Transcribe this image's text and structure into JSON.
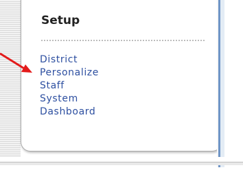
{
  "setup": {
    "title": "Setup",
    "items": [
      {
        "label": "District"
      },
      {
        "label": "Personalize"
      },
      {
        "label": "Staff"
      },
      {
        "label": "System"
      },
      {
        "label": "Dashboard"
      }
    ]
  },
  "annotation": {
    "color": "#e31b1b",
    "points_to": "Personalize"
  },
  "colors": {
    "link": "#2d4fa0",
    "accent_line": "#6f95c6"
  }
}
